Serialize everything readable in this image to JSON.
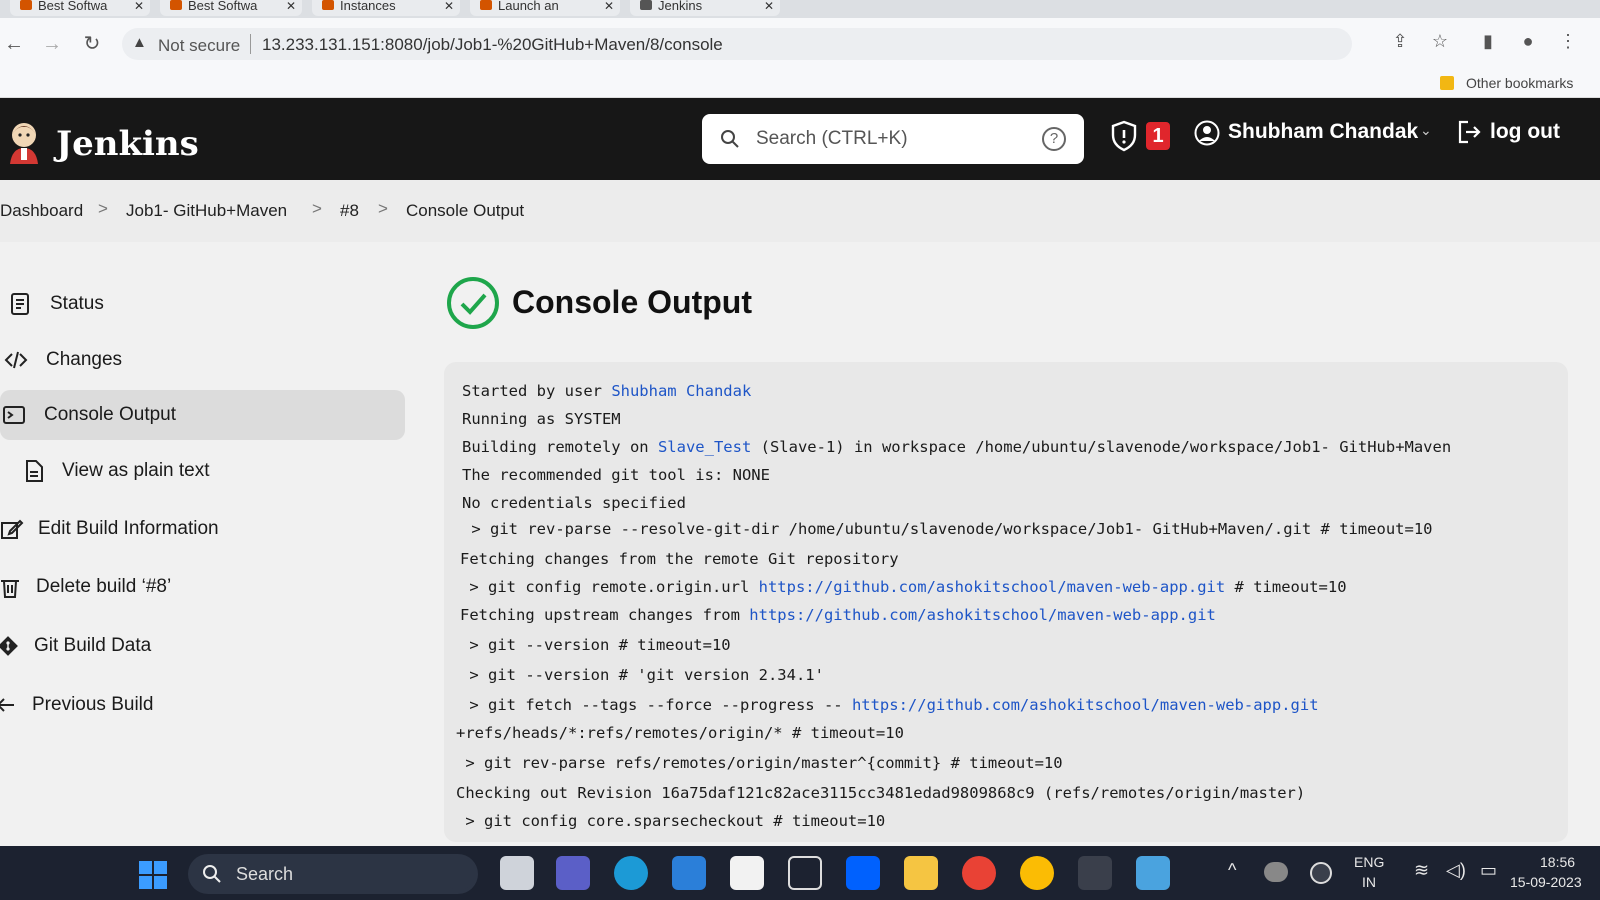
{
  "browser": {
    "tabs": [
      {
        "label": "Best Softwa",
        "close": "✕"
      },
      {
        "label": "Best Softwa",
        "close": "✕"
      },
      {
        "label": "Instances",
        "close": "✕"
      },
      {
        "label": "Launch an",
        "close": "✕"
      },
      {
        "label": "Jenkins",
        "close": "✕"
      }
    ],
    "security_label": "Not secure",
    "url": "13.233.131.151:8080/job/Job1-%20GitHub+Maven/8/console",
    "bookmarks_label": "Other bookmarks"
  },
  "header": {
    "brand": "Jenkins",
    "search_placeholder": "Search (CTRL+K)",
    "help_glyph": "?",
    "notification_count": "1",
    "user_name": "Shubham Chandak",
    "logout_label": "log out"
  },
  "breadcrumb": {
    "items": [
      "Dashboard",
      "Job1- GitHub+Maven",
      "#8",
      "Console Output"
    ],
    "separator": ">"
  },
  "sidebar": {
    "items": [
      {
        "label": "Status",
        "icon": "document-icon"
      },
      {
        "label": "Changes",
        "icon": "code-icon"
      },
      {
        "label": "Console Output",
        "icon": "terminal-icon",
        "active": true
      },
      {
        "label": "View as plain text",
        "icon": "text-file-icon"
      },
      {
        "label": "Edit Build Information",
        "icon": "edit-icon"
      },
      {
        "label": "Delete build ‘#8’",
        "icon": "trash-icon"
      },
      {
        "label": "Git Build Data",
        "icon": "git-icon"
      },
      {
        "label": "Previous Build",
        "icon": "arrow-left-icon"
      }
    ]
  },
  "main": {
    "title": "Console Output",
    "status": "success",
    "lines": [
      {
        "segments": [
          {
            "text": "Started by user "
          },
          {
            "text": "Shubham Chandak",
            "link": true
          }
        ]
      },
      {
        "segments": [
          {
            "text": "Running as SYSTEM"
          }
        ]
      },
      {
        "segments": [
          {
            "text": "Building remotely on "
          },
          {
            "text": "Slave_Test",
            "link": true
          },
          {
            "text": " (Slave-1) in workspace /home/ubuntu/slavenode/workspace/Job1- GitHub+Maven"
          }
        ]
      },
      {
        "segments": [
          {
            "text": "The recommended git tool is: NONE"
          }
        ]
      },
      {
        "segments": [
          {
            "text": "No credentials specified"
          }
        ]
      },
      {
        "segments": [
          {
            "text": " > git rev-parse --resolve-git-dir /home/ubuntu/slavenode/workspace/Job1- GitHub+Maven/.git # timeout=10"
          }
        ]
      },
      {
        "segments": [
          {
            "text": "Fetching changes from the remote Git repository"
          }
        ]
      },
      {
        "segments": [
          {
            "text": " > git config remote.origin.url "
          },
          {
            "text": "https://github.com/ashokitschool/maven-web-app.git",
            "link": true
          },
          {
            "text": " # timeout=10"
          }
        ]
      },
      {
        "segments": [
          {
            "text": "Fetching upstream changes from "
          },
          {
            "text": "https://github.com/ashokitschool/maven-web-app.git",
            "link": true
          }
        ]
      },
      {
        "segments": [
          {
            "text": " > git --version # timeout=10"
          }
        ]
      },
      {
        "segments": [
          {
            "text": " > git --version # 'git version 2.34.1'"
          }
        ]
      },
      {
        "segments": [
          {
            "text": " > git fetch --tags --force --progress -- "
          },
          {
            "text": "https://github.com/ashokitschool/maven-web-app.git",
            "link": true
          }
        ]
      },
      {
        "segments": [
          {
            "text": "+refs/heads/*:refs/remotes/origin/* # timeout=10"
          }
        ]
      },
      {
        "segments": [
          {
            "text": " > git rev-parse refs/remotes/origin/master^{commit} # timeout=10"
          }
        ]
      },
      {
        "segments": [
          {
            "text": "Checking out Revision 16a75daf121c82ace3115cc3481edad9809868c9 (refs/remotes/origin/master)"
          }
        ]
      },
      {
        "segments": [
          {
            "text": " > git config core.sparsecheckout # timeout=10"
          }
        ]
      }
    ]
  },
  "taskbar": {
    "search_label": "Search",
    "language": "ENG",
    "region": "IN",
    "time": "18:56",
    "date": "15-09-2023"
  },
  "colors": {
    "header_bg": "#171717",
    "link": "#1e55c7",
    "success": "#1ea64b",
    "badge": "#e0262c"
  }
}
